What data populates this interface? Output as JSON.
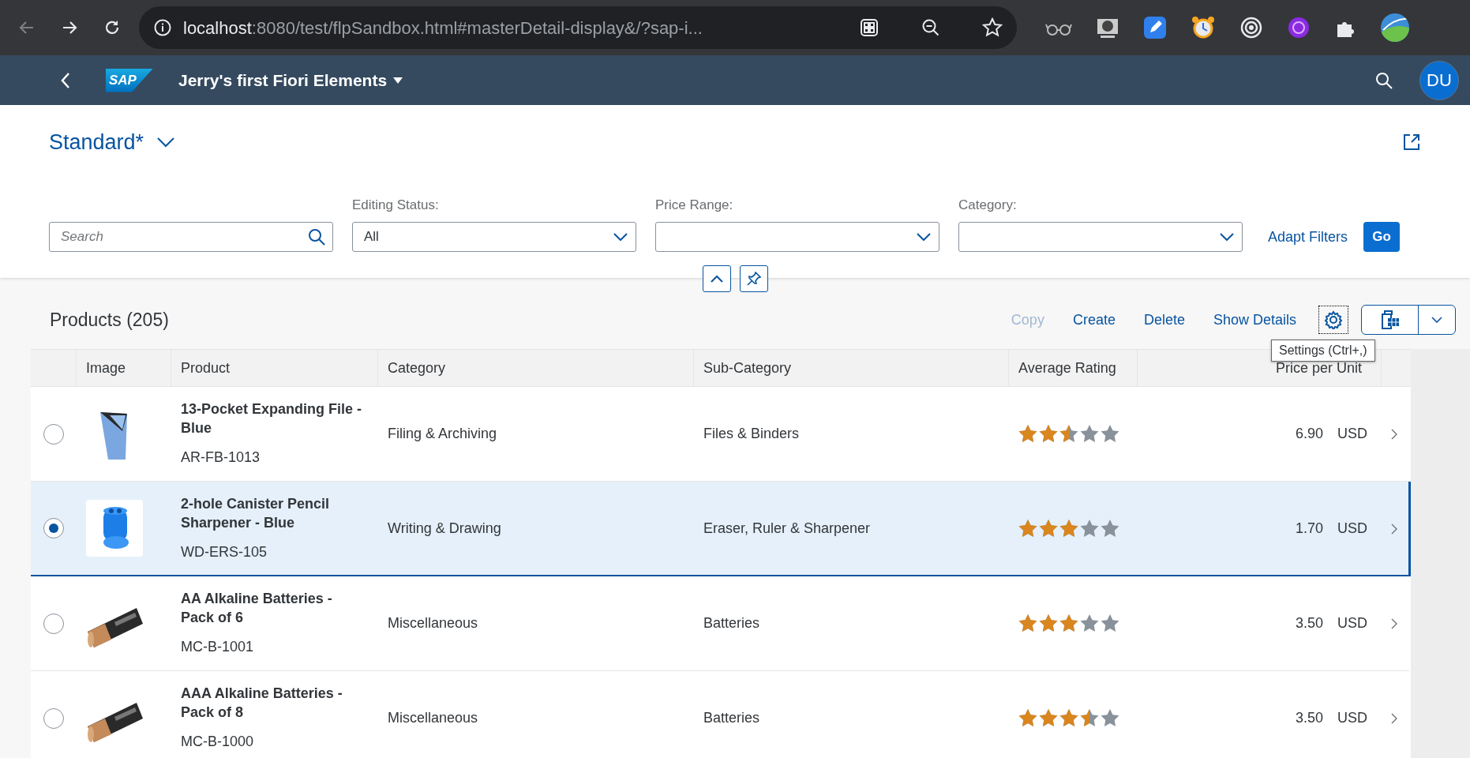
{
  "browser": {
    "url_host": "localhost",
    "url_rest": ":8080/test/flpSandbox.html#masterDetail-display&/?sap-i..."
  },
  "shell": {
    "logo": "SAP",
    "title": "Jerry's first Fiori Elements",
    "avatar": "DU"
  },
  "variant": {
    "name": "Standard*"
  },
  "filters": {
    "search_placeholder": "Search",
    "fields": [
      {
        "label": "Editing Status:",
        "value": "All"
      },
      {
        "label": "Price Range:"
      },
      {
        "label": "Category:"
      }
    ],
    "adapt": "Adapt Filters",
    "go": "Go"
  },
  "table": {
    "title": "Products (205)",
    "actions": [
      {
        "label": "Copy",
        "disabled": true
      },
      {
        "label": "Create",
        "disabled": false
      },
      {
        "label": "Delete",
        "disabled": false
      },
      {
        "label": "Show Details",
        "disabled": false
      }
    ],
    "tooltip": "Settings (Ctrl+,)",
    "columns": [
      "Image",
      "Product",
      "Category",
      "Sub-Category",
      "Average Rating",
      "Price per Unit"
    ],
    "rows": [
      {
        "name": "13-Pocket Expanding File - Blue",
        "code": "AR-FB-1013",
        "category": "Filing & Archiving",
        "subcategory": "Files & Binders",
        "stars": 2.5,
        "price": "6.90",
        "currency": "USD",
        "selected": false
      },
      {
        "name": "2-hole Canister Pencil Sharpener - Blue",
        "code": "WD-ERS-105",
        "category": "Writing & Drawing",
        "subcategory": "Eraser, Ruler & Sharpener",
        "stars": 3,
        "price": "1.70",
        "currency": "USD",
        "selected": true
      },
      {
        "name": "AA Alkaline Batteries - Pack of 6",
        "code": "MC-B-1001",
        "category": "Miscellaneous",
        "subcategory": "Batteries",
        "stars": 3,
        "price": "3.50",
        "currency": "USD",
        "selected": false
      },
      {
        "name": "AAA Alkaline Batteries - Pack of 8",
        "code": "MC-B-1000",
        "category": "Miscellaneous",
        "subcategory": "Batteries",
        "stars": 3.5,
        "price": "3.50",
        "currency": "USD",
        "selected": false
      }
    ]
  }
}
